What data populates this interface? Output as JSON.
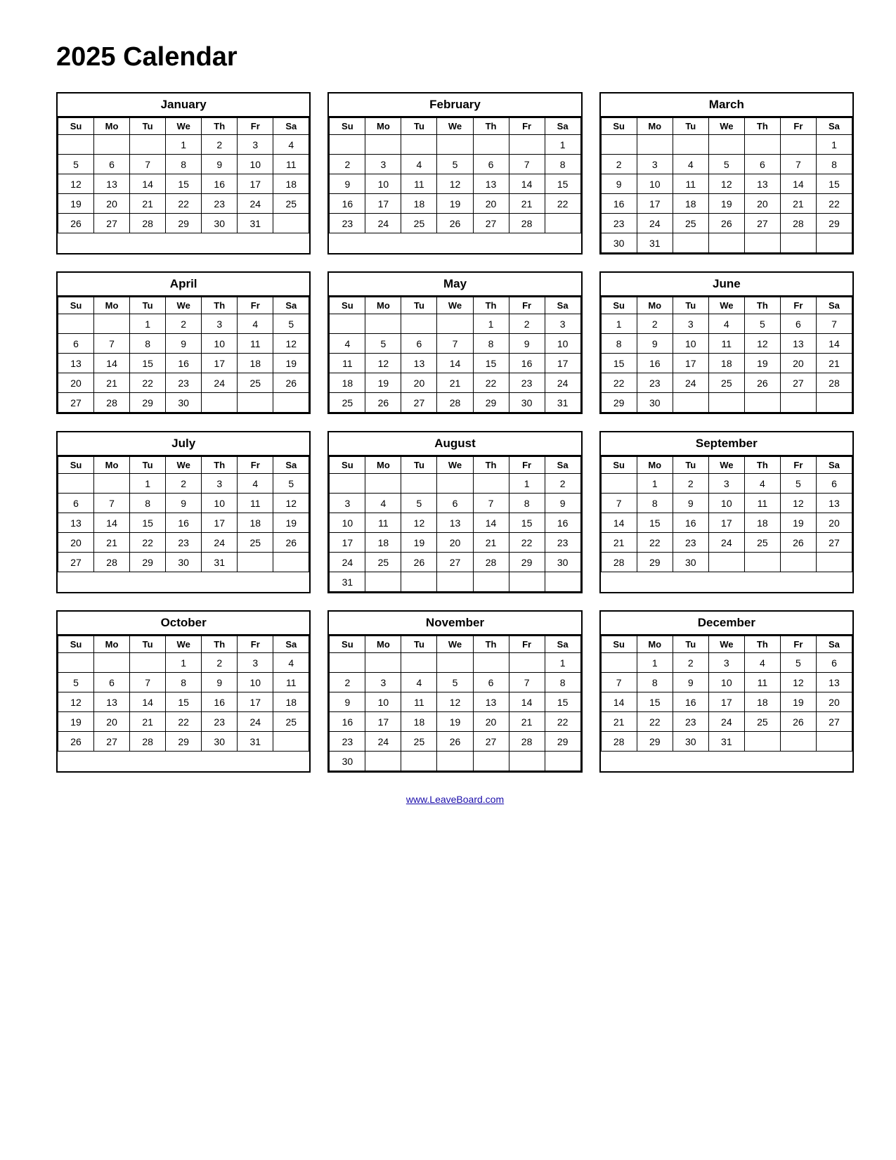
{
  "title": "2025 Calendar",
  "footer_link": "www.LeaveBoard.com",
  "days_header": [
    "Su",
    "Mo",
    "Tu",
    "We",
    "Th",
    "Fr",
    "Sa"
  ],
  "months": [
    {
      "name": "January",
      "weeks": [
        [
          "",
          "",
          "",
          "1",
          "2",
          "3",
          "4"
        ],
        [
          "5",
          "6",
          "7",
          "8",
          "9",
          "10",
          "11"
        ],
        [
          "12",
          "13",
          "14",
          "15",
          "16",
          "17",
          "18"
        ],
        [
          "19",
          "20",
          "21",
          "22",
          "23",
          "24",
          "25"
        ],
        [
          "26",
          "27",
          "28",
          "29",
          "30",
          "31",
          ""
        ]
      ]
    },
    {
      "name": "February",
      "weeks": [
        [
          "",
          "",
          "",
          "",
          "",
          "",
          "1"
        ],
        [
          "2",
          "3",
          "4",
          "5",
          "6",
          "7",
          "8"
        ],
        [
          "9",
          "10",
          "11",
          "12",
          "13",
          "14",
          "15"
        ],
        [
          "16",
          "17",
          "18",
          "19",
          "20",
          "21",
          "22"
        ],
        [
          "23",
          "24",
          "25",
          "26",
          "27",
          "28",
          ""
        ]
      ]
    },
    {
      "name": "March",
      "weeks": [
        [
          "",
          "",
          "",
          "",
          "",
          "",
          "1"
        ],
        [
          "2",
          "3",
          "4",
          "5",
          "6",
          "7",
          "8"
        ],
        [
          "9",
          "10",
          "11",
          "12",
          "13",
          "14",
          "15"
        ],
        [
          "16",
          "17",
          "18",
          "19",
          "20",
          "21",
          "22"
        ],
        [
          "23",
          "24",
          "25",
          "26",
          "27",
          "28",
          "29"
        ],
        [
          "30",
          "31",
          "",
          "",
          "",
          "",
          ""
        ]
      ]
    },
    {
      "name": "April",
      "weeks": [
        [
          "",
          "",
          "1",
          "2",
          "3",
          "4",
          "5"
        ],
        [
          "6",
          "7",
          "8",
          "9",
          "10",
          "11",
          "12"
        ],
        [
          "13",
          "14",
          "15",
          "16",
          "17",
          "18",
          "19"
        ],
        [
          "20",
          "21",
          "22",
          "23",
          "24",
          "25",
          "26"
        ],
        [
          "27",
          "28",
          "29",
          "30",
          "",
          "",
          ""
        ]
      ]
    },
    {
      "name": "May",
      "weeks": [
        [
          "",
          "",
          "",
          "",
          "1",
          "2",
          "3"
        ],
        [
          "4",
          "5",
          "6",
          "7",
          "8",
          "9",
          "10"
        ],
        [
          "11",
          "12",
          "13",
          "14",
          "15",
          "16",
          "17"
        ],
        [
          "18",
          "19",
          "20",
          "21",
          "22",
          "23",
          "24"
        ],
        [
          "25",
          "26",
          "27",
          "28",
          "29",
          "30",
          "31"
        ]
      ]
    },
    {
      "name": "June",
      "weeks": [
        [
          "1",
          "2",
          "3",
          "4",
          "5",
          "6",
          "7"
        ],
        [
          "8",
          "9",
          "10",
          "11",
          "12",
          "13",
          "14"
        ],
        [
          "15",
          "16",
          "17",
          "18",
          "19",
          "20",
          "21"
        ],
        [
          "22",
          "23",
          "24",
          "25",
          "26",
          "27",
          "28"
        ],
        [
          "29",
          "30",
          "",
          "",
          "",
          "",
          ""
        ]
      ]
    },
    {
      "name": "July",
      "weeks": [
        [
          "",
          "",
          "1",
          "2",
          "3",
          "4",
          "5"
        ],
        [
          "6",
          "7",
          "8",
          "9",
          "10",
          "11",
          "12"
        ],
        [
          "13",
          "14",
          "15",
          "16",
          "17",
          "18",
          "19"
        ],
        [
          "20",
          "21",
          "22",
          "23",
          "24",
          "25",
          "26"
        ],
        [
          "27",
          "28",
          "29",
          "30",
          "31",
          "",
          ""
        ]
      ]
    },
    {
      "name": "August",
      "weeks": [
        [
          "",
          "",
          "",
          "",
          "",
          "1",
          "2"
        ],
        [
          "3",
          "4",
          "5",
          "6",
          "7",
          "8",
          "9"
        ],
        [
          "10",
          "11",
          "12",
          "13",
          "14",
          "15",
          "16"
        ],
        [
          "17",
          "18",
          "19",
          "20",
          "21",
          "22",
          "23"
        ],
        [
          "24",
          "25",
          "26",
          "27",
          "28",
          "29",
          "30"
        ],
        [
          "31",
          "",
          "",
          "",
          "",
          "",
          ""
        ]
      ]
    },
    {
      "name": "September",
      "weeks": [
        [
          "",
          "1",
          "2",
          "3",
          "4",
          "5",
          "6"
        ],
        [
          "7",
          "8",
          "9",
          "10",
          "11",
          "12",
          "13"
        ],
        [
          "14",
          "15",
          "16",
          "17",
          "18",
          "19",
          "20"
        ],
        [
          "21",
          "22",
          "23",
          "24",
          "25",
          "26",
          "27"
        ],
        [
          "28",
          "29",
          "30",
          "",
          "",
          "",
          ""
        ]
      ]
    },
    {
      "name": "October",
      "weeks": [
        [
          "",
          "",
          "",
          "1",
          "2",
          "3",
          "4"
        ],
        [
          "5",
          "6",
          "7",
          "8",
          "9",
          "10",
          "11"
        ],
        [
          "12",
          "13",
          "14",
          "15",
          "16",
          "17",
          "18"
        ],
        [
          "19",
          "20",
          "21",
          "22",
          "23",
          "24",
          "25"
        ],
        [
          "26",
          "27",
          "28",
          "29",
          "30",
          "31",
          ""
        ]
      ]
    },
    {
      "name": "November",
      "weeks": [
        [
          "",
          "",
          "",
          "",
          "",
          "",
          "1"
        ],
        [
          "2",
          "3",
          "4",
          "5",
          "6",
          "7",
          "8"
        ],
        [
          "9",
          "10",
          "11",
          "12",
          "13",
          "14",
          "15"
        ],
        [
          "16",
          "17",
          "18",
          "19",
          "20",
          "21",
          "22"
        ],
        [
          "23",
          "24",
          "25",
          "26",
          "27",
          "28",
          "29"
        ],
        [
          "30",
          "",
          "",
          "",
          "",
          "",
          ""
        ]
      ]
    },
    {
      "name": "December",
      "weeks": [
        [
          "",
          "1",
          "2",
          "3",
          "4",
          "5",
          "6"
        ],
        [
          "7",
          "8",
          "9",
          "10",
          "11",
          "12",
          "13"
        ],
        [
          "14",
          "15",
          "16",
          "17",
          "18",
          "19",
          "20"
        ],
        [
          "21",
          "22",
          "23",
          "24",
          "25",
          "26",
          "27"
        ],
        [
          "28",
          "29",
          "30",
          "31",
          "",
          "",
          ""
        ]
      ]
    }
  ]
}
